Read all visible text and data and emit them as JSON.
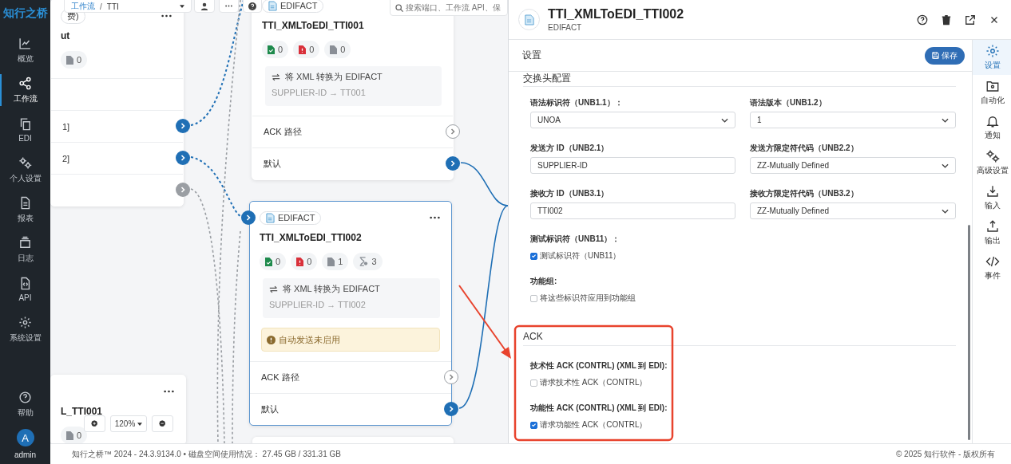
{
  "sidebar": {
    "logo": "知行之桥",
    "items": [
      {
        "label": "概览",
        "selected": false
      },
      {
        "label": "工作流",
        "selected": true
      },
      {
        "label": "EDI",
        "selected": false
      },
      {
        "label": "个人设置",
        "selected": false
      },
      {
        "label": "报表",
        "selected": false
      },
      {
        "label": "日志",
        "selected": false
      },
      {
        "label": "API",
        "selected": false
      },
      {
        "label": "系统设置",
        "selected": false
      }
    ],
    "help": "帮助",
    "user": {
      "initial": "A",
      "name": "admin"
    }
  },
  "toolbar": {
    "breadcrumb": [
      "工作流",
      "TTI"
    ],
    "breadcrumb_separator": "/",
    "search_placeholder": "搜索端口、工作流 API、保"
  },
  "canvas": {
    "zoom": "120%",
    "nodes": [
      {
        "tag": {
          "text": "费)",
          "icon": false
        },
        "menu": true,
        "title": "ut",
        "counters": [
          {
            "kind": "file",
            "value": "0"
          }
        ],
        "ports": [
          {
            "port": false
          },
          {
            "label": "1]",
            "port": true,
            "connected": true,
            "enabled": true
          },
          {
            "label": "2]",
            "port": true,
            "connected": true,
            "enabled": true
          },
          {
            "port": true,
            "connected": true,
            "enabled": false
          }
        ],
        "selected": false
      },
      {
        "tag": {
          "text": "EDIFACT",
          "icon": true
        },
        "menu": false,
        "title": "TTI_XMLToEDI_TTI001",
        "counters": [
          {
            "kind": "success",
            "value": "0"
          },
          {
            "kind": "error",
            "value": "0"
          },
          {
            "kind": "file",
            "value": "0"
          }
        ],
        "description": {
          "title": "将 XML 转换为 EDIFACT",
          "mapping": "SUPPLIER-ID → TT001"
        },
        "ports": [
          {
            "label": "ACK 路径",
            "port": true,
            "connected": false
          },
          {
            "label": "默认",
            "port": true,
            "connected": true,
            "enabled": true
          }
        ],
        "selected": false
      },
      {
        "input_connected": true,
        "tag": {
          "text": "EDIFACT",
          "icon": true
        },
        "menu": true,
        "title": "TTI_XMLToEDI_TTI002",
        "counters": [
          {
            "kind": "success",
            "value": "0"
          },
          {
            "kind": "error",
            "value": "0"
          },
          {
            "kind": "file",
            "value": "1"
          },
          {
            "kind": "pending",
            "value": "3"
          }
        ],
        "description": {
          "title": "将 XML 转换为 EDIFACT",
          "mapping": "SUPPLIER-ID → TTI002"
        },
        "warning": "自动发送未启用",
        "ports": [
          {
            "label": "ACK 路径",
            "port": true,
            "connected": false
          },
          {
            "label": "默认",
            "port": true,
            "connected": true,
            "enabled": true
          }
        ],
        "selected": true
      },
      {
        "menu": true,
        "title": "L_TTI001",
        "counters": [
          {
            "kind": "file",
            "value": "0"
          }
        ],
        "selected": false
      },
      {
        "selected": false
      }
    ]
  },
  "panel": {
    "title": "TTI_XMLToEDI_TTI002",
    "subtitle": "EDIFACT",
    "heading": "设置",
    "save": "保存",
    "tabs": [
      {
        "label": "设置",
        "selected": true
      },
      {
        "label": "自动化",
        "selected": false
      },
      {
        "label": "通知",
        "selected": false
      },
      {
        "label": "高级设置",
        "selected": false
      },
      {
        "label": "输入",
        "selected": false
      },
      {
        "label": "输出",
        "selected": false
      },
      {
        "label": "事件",
        "selected": false
      }
    ],
    "sections": [
      {
        "title": "交换头配置",
        "fields": [
          {
            "label": "语法标识符（UNB1.1）：",
            "value": "UNOA",
            "kind": "select"
          },
          {
            "label": "语法版本（UNB1.2）",
            "value": "1",
            "kind": "select"
          },
          {
            "label": "发送方 ID（UNB2.1）",
            "value": "SUPPLIER-ID",
            "kind": "text"
          },
          {
            "label": "发送方限定符代码（UNB2.2）",
            "value": "ZZ-Mutually Defined",
            "kind": "select"
          },
          {
            "label": "接收方 ID（UNB3.1）",
            "value": "TTI002",
            "kind": "text"
          },
          {
            "label": "接收方限定符代码（UNB3.2）",
            "value": "ZZ-Mutually Defined",
            "kind": "select"
          }
        ],
        "options": [
          {
            "label": "测试标识符（UNB11）：",
            "option": "测试标识符（UNB11）",
            "checked": true
          },
          {
            "label": "功能组:",
            "option": "将这些标识符应用到功能组",
            "checked": false
          }
        ]
      },
      {
        "title": "ACK",
        "options": [
          {
            "label": "技术性 ACK (CONTRL) (XML 到 EDI):",
            "option": "请求技术性 ACK（CONTRL）",
            "checked": false
          },
          {
            "label": "功能性 ACK (CONTRL) (XML 到 EDI):",
            "option": "请求功能性 ACK（CONTRL）",
            "checked": true
          }
        ]
      }
    ]
  },
  "footer": {
    "left": "知行之桥™ 2024 - 24.3.9134.0 • 磁盘空间使用情况： 27.45 GB / 331.31 GB",
    "right": "© 2025 知行软件 - 版权所有"
  }
}
